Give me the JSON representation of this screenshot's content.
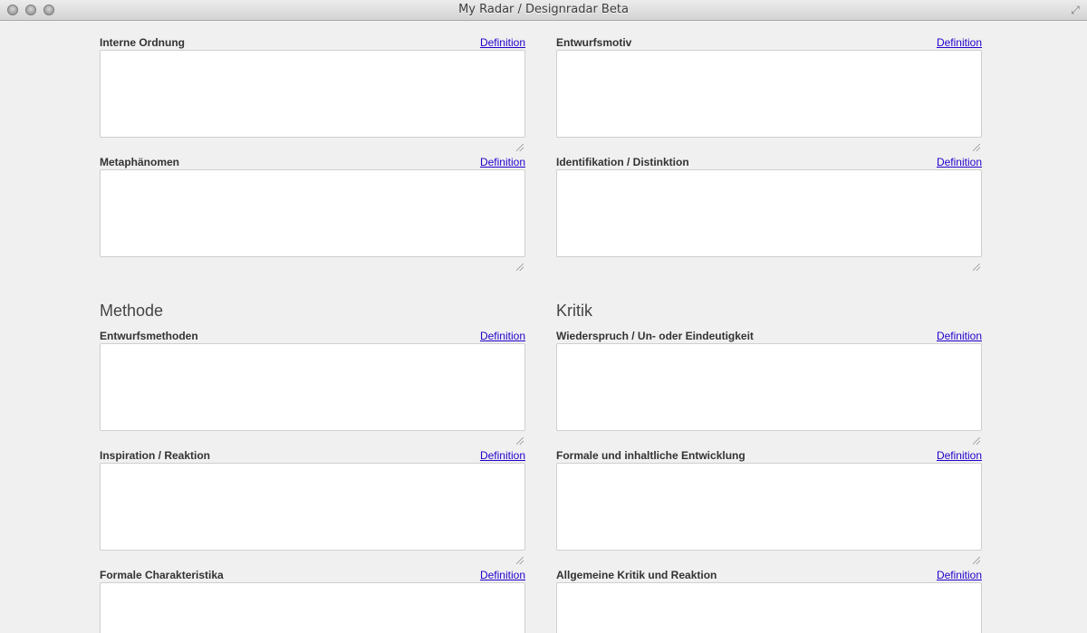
{
  "window": {
    "title": "My Radar / Designradar Beta"
  },
  "common": {
    "definition_label": "Definition"
  },
  "upper_left": [
    {
      "label": "Interne Ordnung",
      "value": ""
    },
    {
      "label": "Metaphänomen",
      "value": ""
    }
  ],
  "upper_right": [
    {
      "label": "Entwurfsmotiv",
      "value": ""
    },
    {
      "label": "Identifikation / Distinktion",
      "value": ""
    }
  ],
  "methode": {
    "heading": "Methode",
    "fields": [
      {
        "label": "Entwurfsmethoden",
        "value": ""
      },
      {
        "label": "Inspiration / Reaktion",
        "value": ""
      },
      {
        "label": "Formale Charakteristika",
        "value": ""
      }
    ]
  },
  "kritik": {
    "heading": "Kritik",
    "fields": [
      {
        "label": "Wiederspruch / Un- oder Eindeutigkeit",
        "value": ""
      },
      {
        "label": "Formale und inhaltliche Entwicklung",
        "value": ""
      },
      {
        "label": "Allgemeine Kritik und Reaktion",
        "value": ""
      }
    ]
  }
}
